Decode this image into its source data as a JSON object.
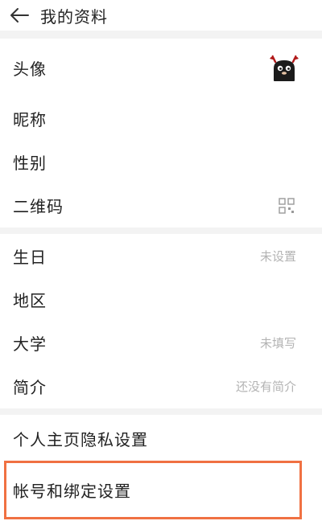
{
  "header": {
    "title": "我的资料",
    "back_icon": "arrow-left-icon"
  },
  "rows": {
    "avatar": {
      "label": "头像"
    },
    "nickname": {
      "label": "昵称"
    },
    "gender": {
      "label": "性别"
    },
    "qrcode": {
      "label": "二维码",
      "icon": "qr-code-icon"
    },
    "birthday": {
      "label": "生日",
      "value": "未设置"
    },
    "region": {
      "label": "地区"
    },
    "university": {
      "label": "大学",
      "value": "未填写"
    },
    "bio": {
      "label": "简介",
      "value": "还没有简介"
    },
    "privacy": {
      "label": "个人主页隐私设置"
    },
    "account": {
      "label": "帐号和绑定设置"
    }
  },
  "colors": {
    "highlight": "#f07142",
    "placeholder": "#b3b3b3"
  }
}
